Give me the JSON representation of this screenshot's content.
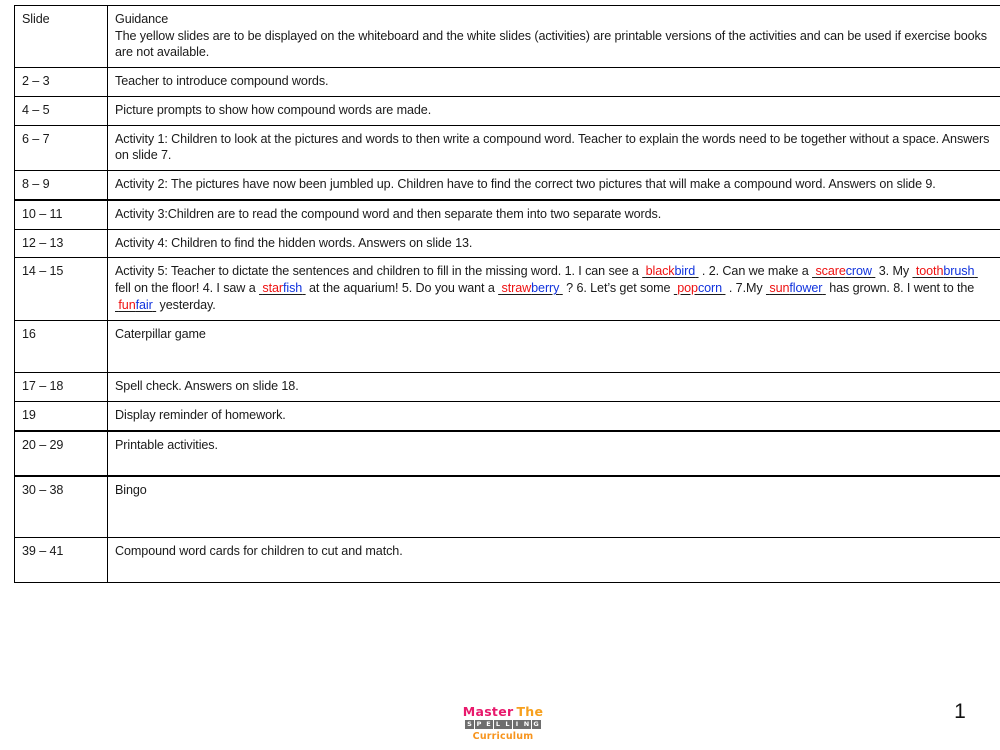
{
  "document": {
    "page_number": "1",
    "colors": {
      "text": "#1a1a1a",
      "border": "#000000",
      "word_part1": "#ee1111",
      "word_part2": "#1133dd",
      "logo_master": "#e8196c",
      "logo_the": "#f7a01d",
      "logo_curriculum": "#f7941d",
      "logo_tile": "#6e6e6e"
    }
  },
  "table": {
    "headers": {
      "slide": "Slide",
      "guidance": "Guidance"
    },
    "header_note": "The yellow slides are to be displayed on the whiteboard and the white slides (activities) are printable versions of the activities and can be used if exercise books are not available.",
    "rows": [
      {
        "slide": "2 – 3",
        "guidance": "Teacher to introduce compound words."
      },
      {
        "slide": "4 – 5",
        "guidance": "Picture prompts to show how compound words are made."
      },
      {
        "slide": "6 – 7",
        "guidance": "Activity 1: Children to look at the pictures and words to then write a compound word. Teacher to explain the words need to be together without a space. Answers on slide 7."
      },
      {
        "slide": "8 – 9",
        "guidance": "Activity 2: The pictures have now been jumbled up. Children have to find the correct two pictures that will make a compound word. Answers on slide 9."
      },
      {
        "slide": "10 – 11",
        "guidance": "Activity 3:Children are to read the compound word and then separate them into two separate words."
      },
      {
        "slide": "12 – 13",
        "guidance": "Activity 4: Children to find the hidden words. Answers on slide 13."
      },
      {
        "slide": "14 – 15",
        "guidance": "ACTIVITY5_RICH"
      },
      {
        "slide": "16",
        "guidance": "Caterpillar game"
      },
      {
        "slide": "17 – 18",
        "guidance": "Spell check. Answers on slide 18."
      },
      {
        "slide": "19",
        "guidance": "Display reminder of homework."
      },
      {
        "slide": "20 – 29",
        "guidance": "Printable activities."
      },
      {
        "slide": "30 – 38",
        "guidance": "Bingo"
      },
      {
        "slide": "39 – 41",
        "guidance": "Compound word cards for children to cut and match."
      }
    ]
  },
  "activity5": {
    "intro": "Activity 5: Teacher to dictate the sentences and children to fill in the missing word.",
    "segments": [
      {
        "type": "text",
        "value": " 1. I can see a "
      },
      {
        "type": "word",
        "part1": "black",
        "part2": "bird"
      },
      {
        "type": "text",
        "value": " . 2. Can we make a "
      },
      {
        "type": "word",
        "part1": "scare",
        "part2": "crow"
      },
      {
        "type": "text",
        "value": " 3. My "
      },
      {
        "type": "word",
        "part1": "tooth",
        "part2": "brush"
      },
      {
        "type": "text",
        "value": " fell on the floor! 4. I saw a "
      },
      {
        "type": "word",
        "part1": "star",
        "part2": "fish"
      },
      {
        "type": "text",
        "value": " at the aquarium!  5. Do you want a "
      },
      {
        "type": "word",
        "part1": "straw",
        "part2": "berry"
      },
      {
        "type": "text",
        "value": " ? 6. Let’s get some "
      },
      {
        "type": "word",
        "part1": "pop",
        "part2": "corn"
      },
      {
        "type": "text",
        "value": " .  7.My "
      },
      {
        "type": "word",
        "part1": "sun",
        "part2": "flower"
      },
      {
        "type": "text",
        "value": " has grown. 8. I went to the "
      },
      {
        "type": "word",
        "part1": "fun",
        "part2": "fair"
      },
      {
        "type": "text",
        "value": " yesterday."
      }
    ]
  },
  "logo": {
    "word1": "Master",
    "word2": "The",
    "tiles": [
      "S",
      "P",
      "E",
      "L",
      "L",
      "I",
      "N",
      "G"
    ],
    "word3": "Curriculum"
  }
}
